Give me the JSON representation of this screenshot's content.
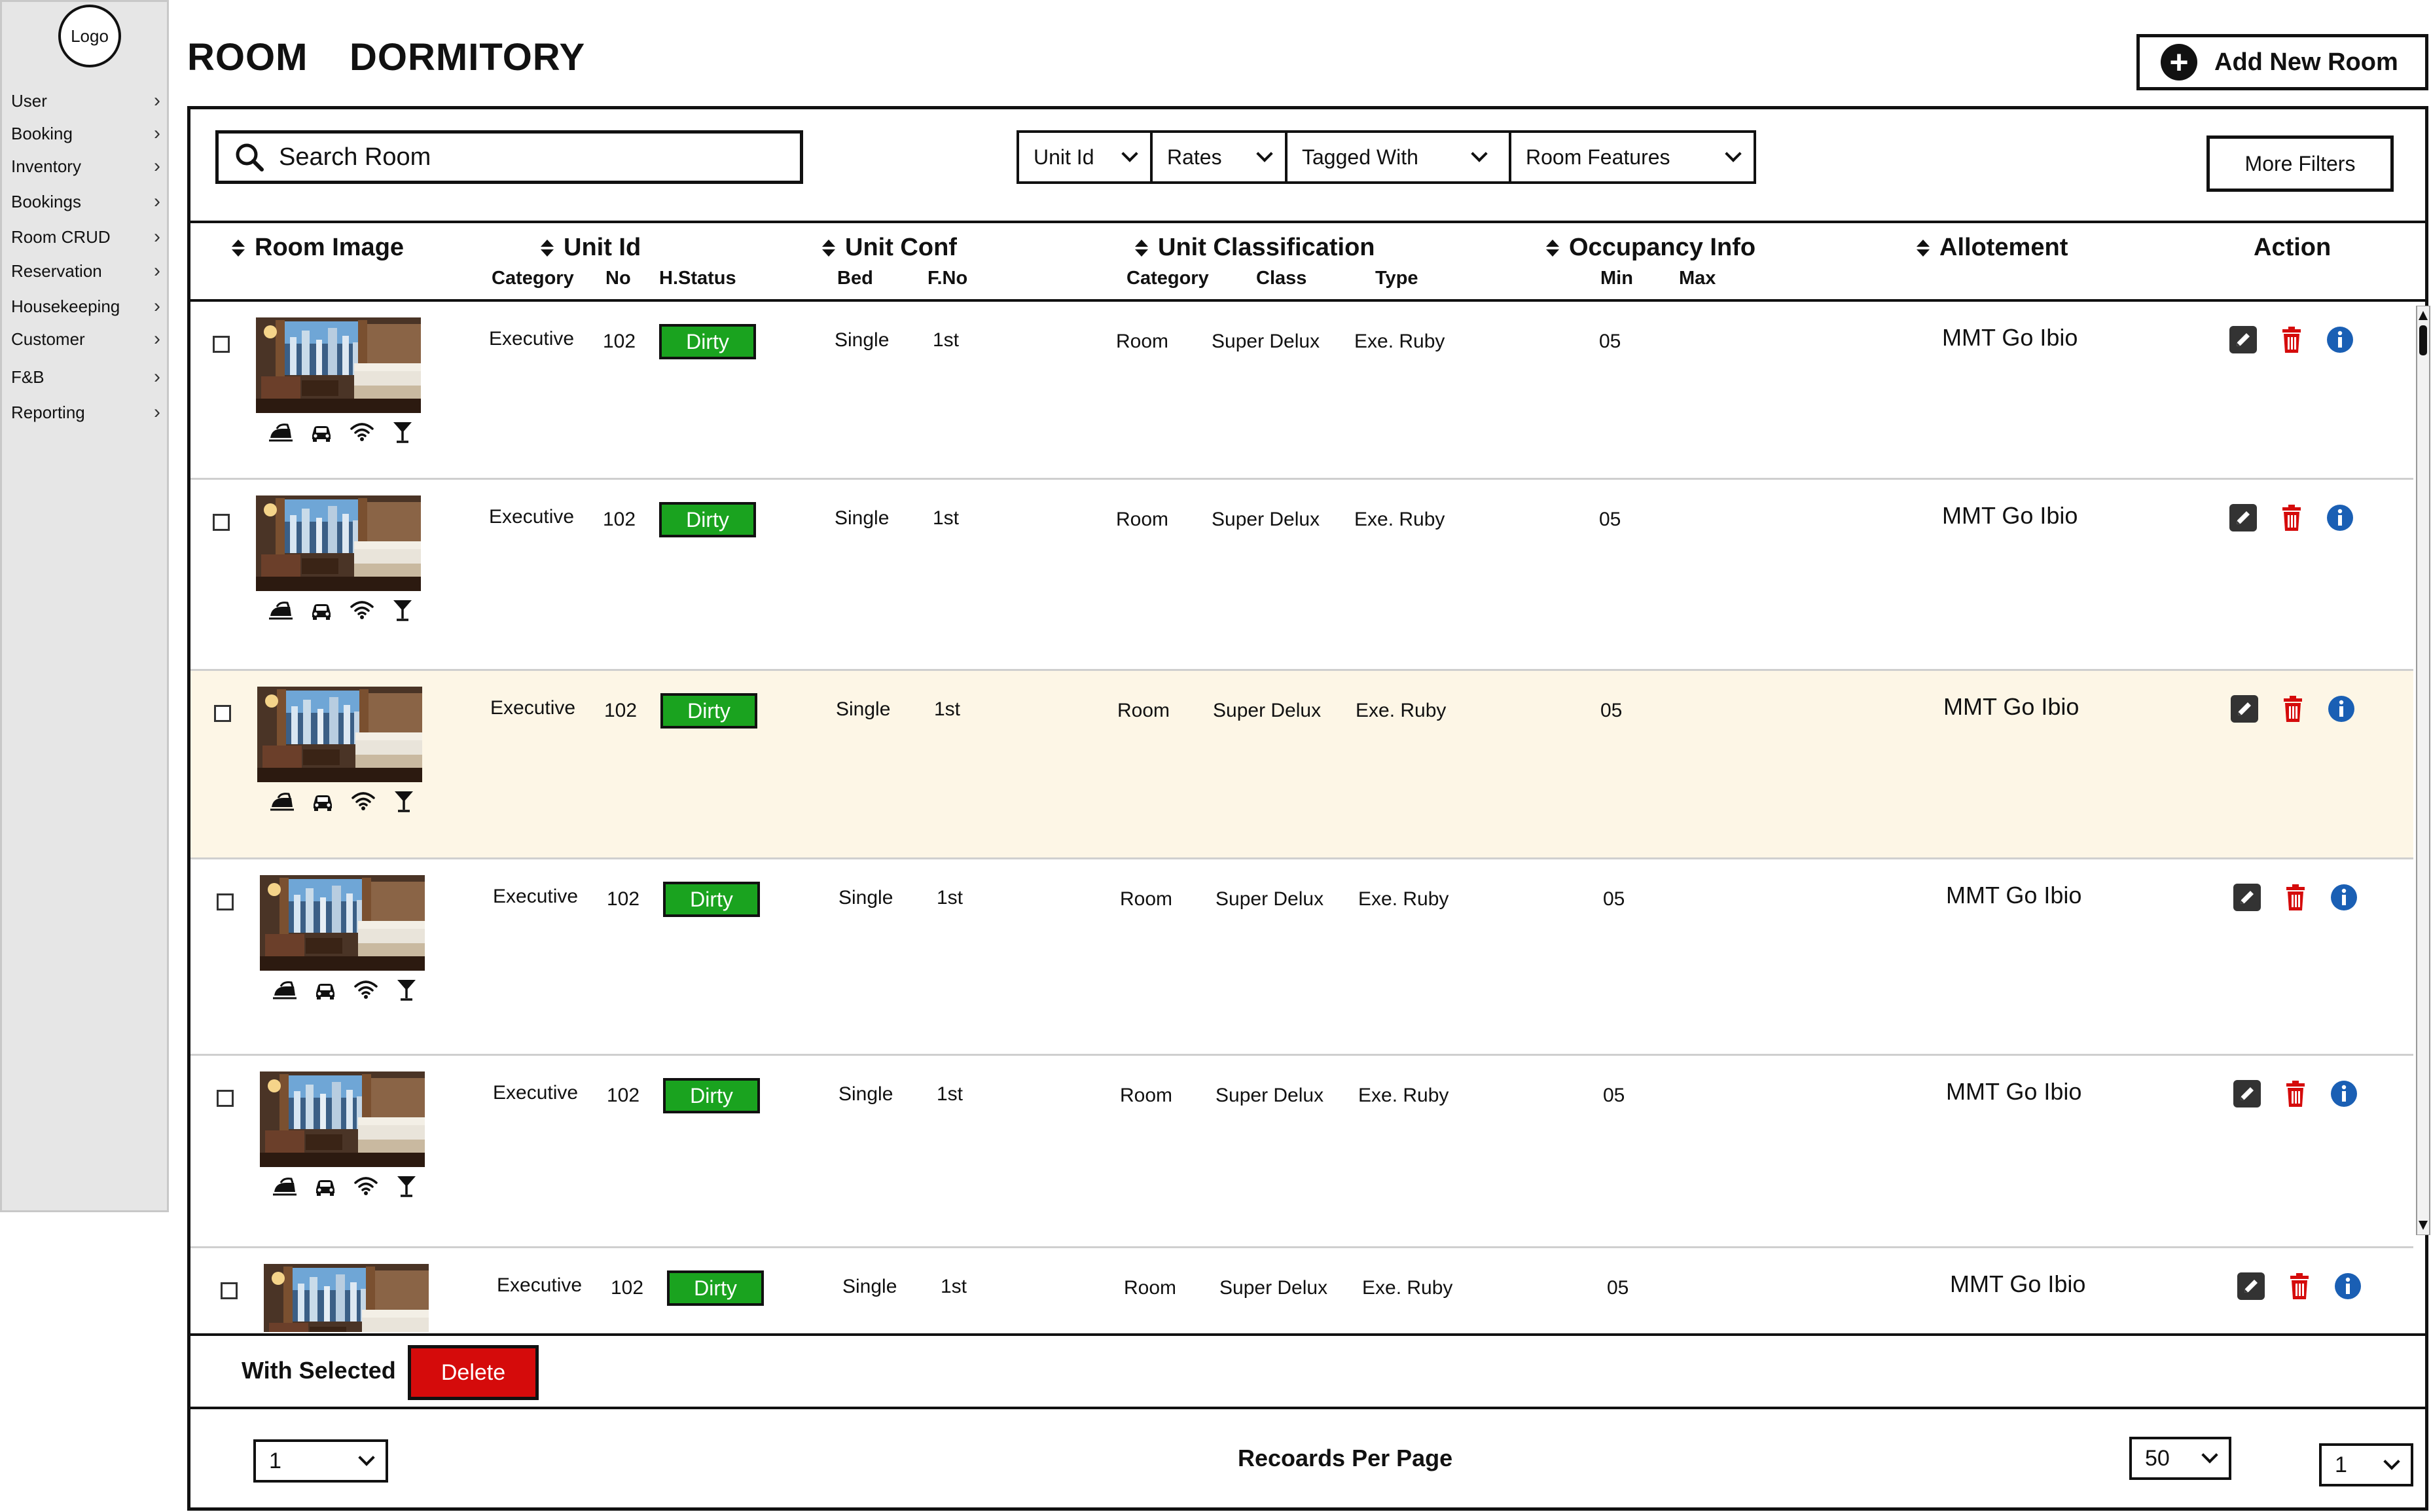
{
  "sidebar": {
    "logo": "Logo",
    "items": [
      {
        "label": "User"
      },
      {
        "label": "Booking"
      },
      {
        "label": "Inventory"
      },
      {
        "label": "Bookings"
      },
      {
        "label": "Room CRUD"
      },
      {
        "label": "Reservation"
      },
      {
        "label": "Housekeeping"
      },
      {
        "label": "Customer"
      },
      {
        "label": "F&B"
      },
      {
        "label": "Reporting"
      }
    ]
  },
  "header": {
    "tabs": [
      "ROOM",
      "DORMITORY"
    ],
    "add_button_label": "Add New Room"
  },
  "filters": {
    "search_placeholder": "Search Room",
    "dropdowns": [
      "Unit Id",
      "Rates",
      "Tagged With",
      "Room Features"
    ],
    "more_filters_label": "More Filters"
  },
  "table": {
    "columns": {
      "room_image": "Room Image",
      "unit_id": "Unit Id",
      "unit_conf": "Unit Conf",
      "unit_classification": "Unit Classification",
      "occupancy_info": "Occupancy Info",
      "allotement": "Allotement",
      "action": "Action"
    },
    "subcolumns": {
      "category": "Category",
      "no": "No",
      "hstatus": "H.Status",
      "bed": "Bed",
      "fno": "F.No",
      "class_category": "Category",
      "class": "Class",
      "type": "Type",
      "min": "Min",
      "max": "Max"
    },
    "amenity_icons": [
      "iron-icon",
      "car-icon",
      "wifi-icon",
      "cocktail-icon"
    ],
    "rows": [
      {
        "category": "Executive",
        "no": "102",
        "status": "Dirty",
        "bed": "Single",
        "floor": "1st",
        "class_category": "Room",
        "class": "Super Delux",
        "type": "Exe. Ruby",
        "min": "05",
        "max": "",
        "allotement": "MMT  Go Ibio"
      },
      {
        "category": "Executive",
        "no": "102",
        "status": "Dirty",
        "bed": "Single",
        "floor": "1st",
        "class_category": "Room",
        "class": "Super Delux",
        "type": "Exe. Ruby",
        "min": "05",
        "max": "",
        "allotement": "MMT  Go Ibio"
      },
      {
        "category": "Executive",
        "no": "102",
        "status": "Dirty",
        "bed": "Single",
        "floor": "1st",
        "class_category": "Room",
        "class": "Super Delux",
        "type": "Exe. Ruby",
        "min": "05",
        "max": "",
        "allotement": "MMT  Go Ibio"
      },
      {
        "category": "Executive",
        "no": "102",
        "status": "Dirty",
        "bed": "Single",
        "floor": "1st",
        "class_category": "Room",
        "class": "Super Delux",
        "type": "Exe. Ruby",
        "min": "05",
        "max": "",
        "allotement": "MMT  Go Ibio"
      },
      {
        "category": "Executive",
        "no": "102",
        "status": "Dirty",
        "bed": "Single",
        "floor": "1st",
        "class_category": "Room",
        "class": "Super Delux",
        "type": "Exe. Ruby",
        "min": "05",
        "max": "",
        "allotement": "MMT  Go Ibio"
      },
      {
        "category": "Executive",
        "no": "102",
        "status": "Dirty",
        "bed": "Single",
        "floor": "1st",
        "class_category": "Room",
        "class": "Super Delux",
        "type": "Exe. Ruby",
        "min": "05",
        "max": "",
        "allotement": "MMT  Go Ibio"
      }
    ],
    "highlighted_row": 2
  },
  "footer": {
    "with_selected": "With Selected",
    "delete_label": "Delete",
    "page_select": "1",
    "records_per_page_label": "Recoards Per Page",
    "records_per_page_value": "50",
    "page_right_select": "1"
  },
  "colors": {
    "status_dirty": "#1aa31f",
    "delete": "#d50b0b",
    "info": "#1a5fb4",
    "highlight_row": "#fdf6e6",
    "sidebar_bg": "#e6e6e6"
  }
}
